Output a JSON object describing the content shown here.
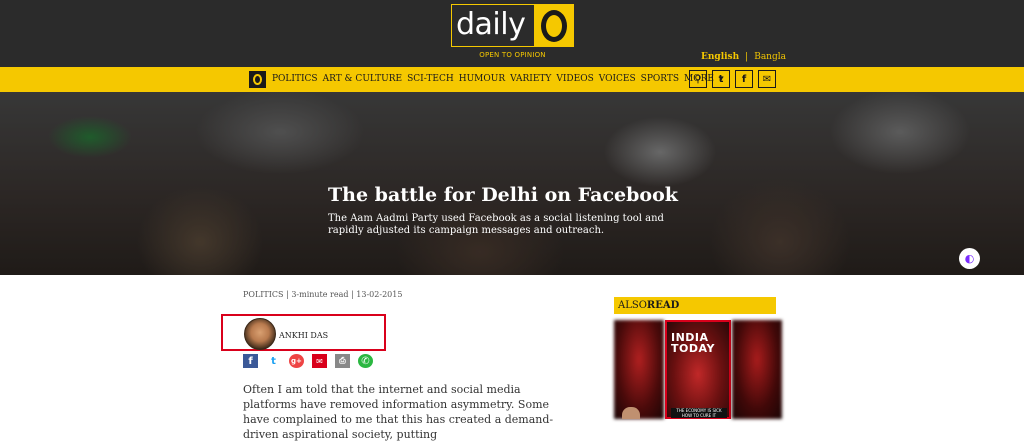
{
  "brand": {
    "word": "daily",
    "tagline": "OPEN TO OPINION"
  },
  "language": {
    "current": "English",
    "separator": "|",
    "alt": "Bangla"
  },
  "nav": {
    "items": [
      "POLITICS",
      "ART & CULTURE",
      "SCI-TECH",
      "HUMOUR",
      "VARIETY",
      "VIDEOS",
      "VOICES",
      "SPORTS",
      "MORE"
    ],
    "icons": [
      "search-icon",
      "twitter-icon",
      "facebook-icon",
      "mail-icon"
    ]
  },
  "hero": {
    "title": "The battle for Delhi on Facebook",
    "subtitle": "The Aam Aadmi Party used Facebook as a social listening tool and rapidly adjusted its campaign messages and outreach."
  },
  "article": {
    "category": "POLITICS",
    "read_time": "3-minute read",
    "date": "13-02-2015",
    "author": "ANKHI DAS",
    "share_icons": [
      "facebook-icon",
      "twitter-icon",
      "google-plus-icon",
      "mail-icon",
      "print-icon",
      "whatsapp-icon"
    ],
    "body": "Often I am told that the internet and social media platforms have removed information asymmetry. Some have complained to me that this has created a demand-driven aspirational society, putting"
  },
  "sidebar": {
    "also_prefix": "ALSO",
    "also_suffix": "READ",
    "cover": {
      "line1": "INDIA",
      "line2": "TODAY",
      "strap": "THE ECONOMY IS SICK HOW TO CURE IT"
    }
  },
  "colors": {
    "accent": "#f5c800",
    "dark": "#2b2b2b",
    "highlight": "#d9001b"
  }
}
